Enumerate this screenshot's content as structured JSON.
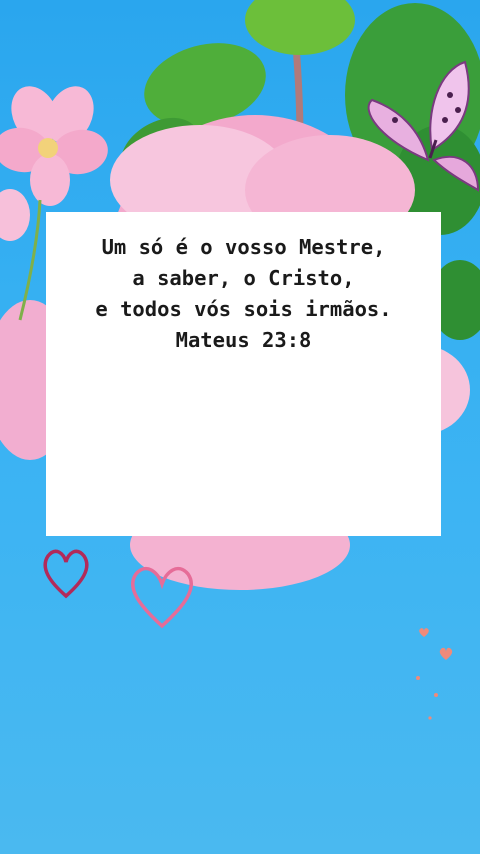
{
  "verse": {
    "lines": [
      "Um só é o vosso Mestre,",
      "a saber, o Cristo,",
      "e todos vós sois irmãos."
    ],
    "reference": "Mateus 23:8"
  },
  "colors": {
    "background": "#36b0f2",
    "card": "#ffffff",
    "text": "#1a1a1a",
    "heart": "#e0507a",
    "flower": "#f6b8d2",
    "leaf": "#3a9e3a"
  },
  "decorations": [
    "pink-flower",
    "green-leaves",
    "pink-butterfly",
    "hearts"
  ]
}
